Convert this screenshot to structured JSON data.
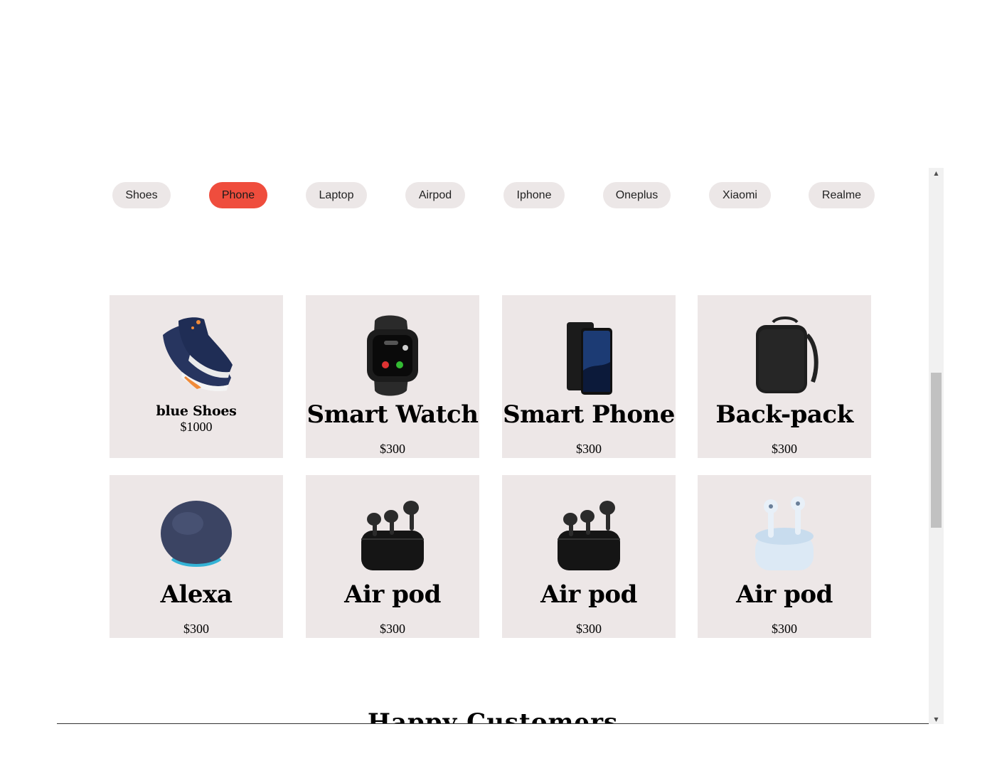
{
  "categories": [
    {
      "label": "Shoes",
      "active": false
    },
    {
      "label": "Phone",
      "active": true
    },
    {
      "label": "Laptop",
      "active": false
    },
    {
      "label": "Airpod",
      "active": false
    },
    {
      "label": "Iphone",
      "active": false
    },
    {
      "label": "Oneplus",
      "active": false
    },
    {
      "label": "Xiaomi",
      "active": false
    },
    {
      "label": "Realme",
      "active": false
    }
  ],
  "products": [
    {
      "name": "blue Shoes",
      "price": "$1000",
      "image": "sneaker-image"
    },
    {
      "name": "Smart Watch",
      "price": "$300",
      "image": "smartwatch-image"
    },
    {
      "name": "Smart Phone",
      "price": "$300",
      "image": "smartphone-image"
    },
    {
      "name": "Back-pack",
      "price": "$300",
      "image": "backpack-image"
    },
    {
      "name": "Alexa",
      "price": "$300",
      "image": "smart-speaker-image"
    },
    {
      "name": "Air pod",
      "price": "$300",
      "image": "airpods-black-image"
    },
    {
      "name": "Air pod",
      "price": "$300",
      "image": "airpods-black-image"
    },
    {
      "name": "Air pod",
      "price": "$300",
      "image": "earbuds-white-image"
    }
  ],
  "section_heading": "Happy Customers",
  "colors": {
    "active_pill": "#ef4d3d",
    "pill": "#ece7e7",
    "card": "#ede7e7"
  }
}
